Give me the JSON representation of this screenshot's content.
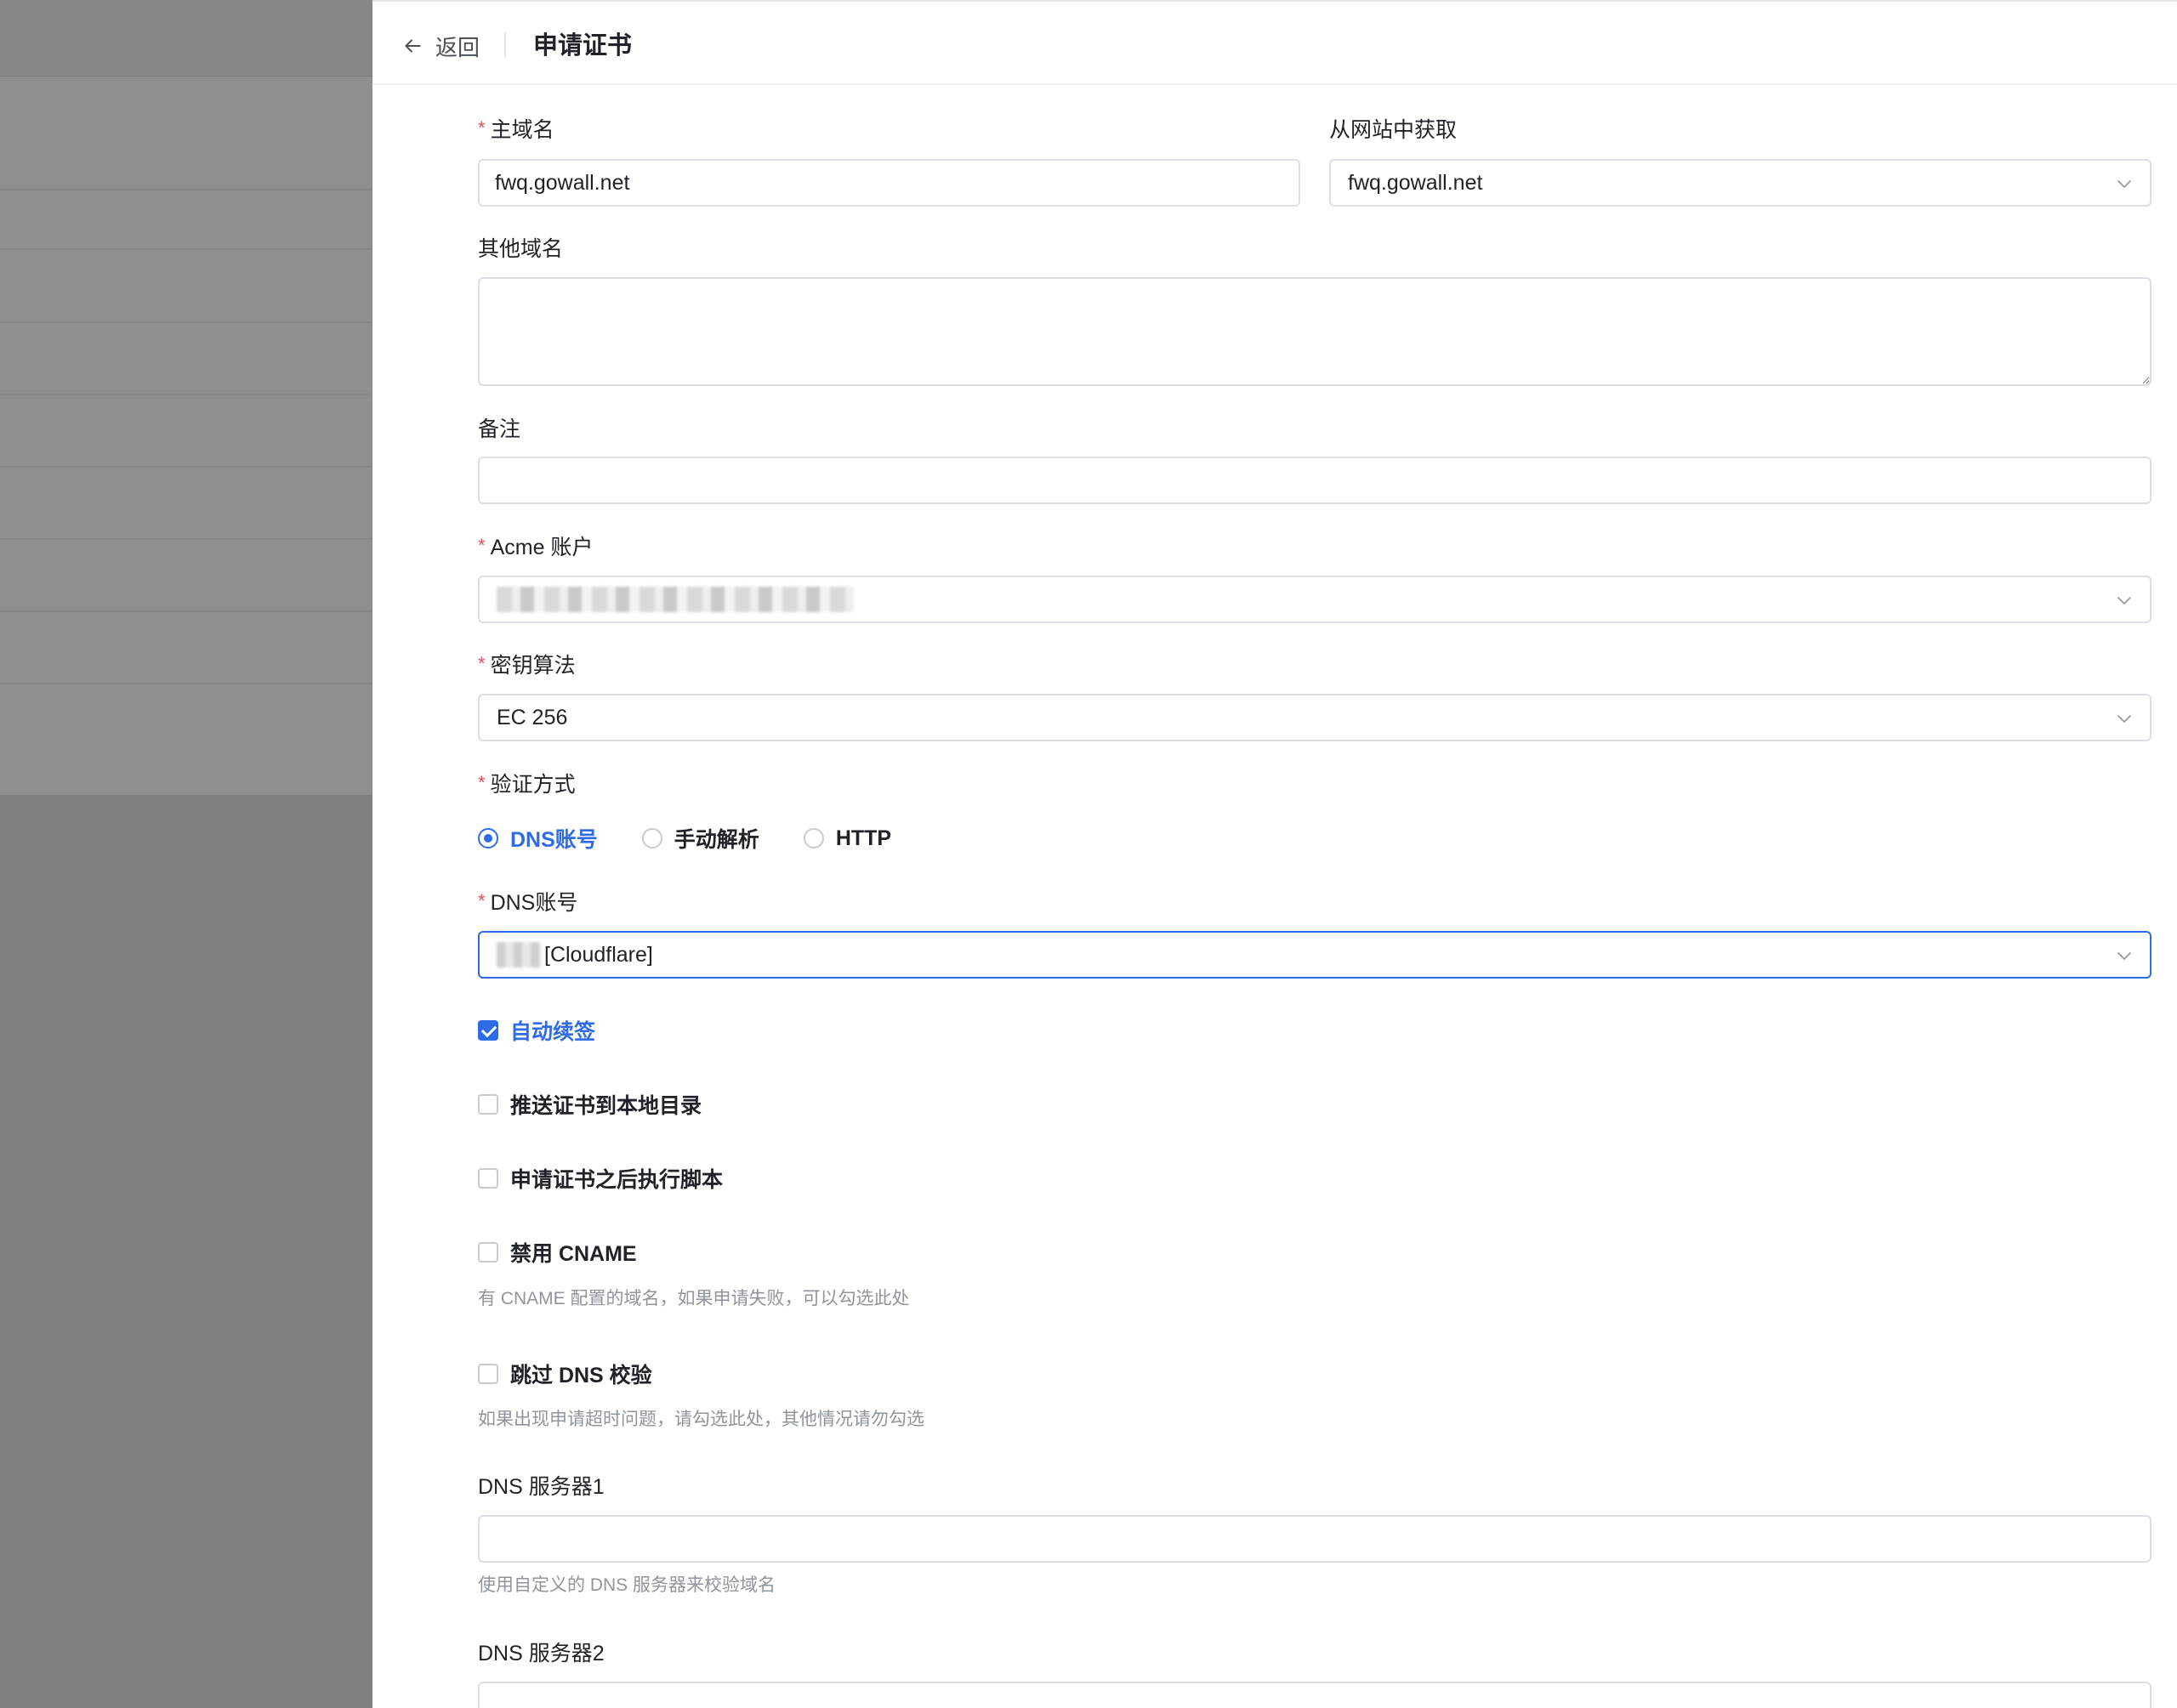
{
  "header": {
    "back_label": "返回",
    "title": "申请证书"
  },
  "form": {
    "main_domain": {
      "label": "主域名",
      "value": "fwq.gowall.net"
    },
    "from_site": {
      "label": "从网站中获取",
      "value": "fwq.gowall.net"
    },
    "other_domains": {
      "label": "其他域名",
      "value": ""
    },
    "remark": {
      "label": "备注",
      "value": ""
    },
    "acme_account": {
      "label": "Acme 账户"
    },
    "key_algo": {
      "label": "密钥算法",
      "value": "EC 256"
    },
    "verify_method": {
      "label": "验证方式",
      "options": [
        "DNS账号",
        "手动解析",
        "HTTP"
      ],
      "selected": "DNS账号"
    },
    "dns_account": {
      "label": "DNS账号",
      "value": "[Cloudflare]"
    },
    "checkboxes": {
      "auto_renew": {
        "label": "自动续签",
        "checked": true
      },
      "push_local": {
        "label": "推送证书到本地目录",
        "checked": false
      },
      "run_script": {
        "label": "申请证书之后执行脚本",
        "checked": false
      },
      "disable_cname": {
        "label": "禁用 CNAME",
        "checked": false,
        "hint": "有 CNAME 配置的域名，如果申请失败，可以勾选此处"
      },
      "skip_dns": {
        "label": "跳过 DNS 校验",
        "checked": false,
        "hint": "如果出现申请超时问题，请勾选此处，其他情况请勿勾选"
      }
    },
    "dns_server1": {
      "label": "DNS 服务器1",
      "value": "",
      "hint": "使用自定义的 DNS 服务器来校验域名"
    },
    "dns_server2": {
      "label": "DNS 服务器2",
      "value": ""
    }
  },
  "colors": {
    "primary": "#2e6be6",
    "required": "#e34d59",
    "hint": "#8f959e",
    "overlay": "#808080"
  }
}
